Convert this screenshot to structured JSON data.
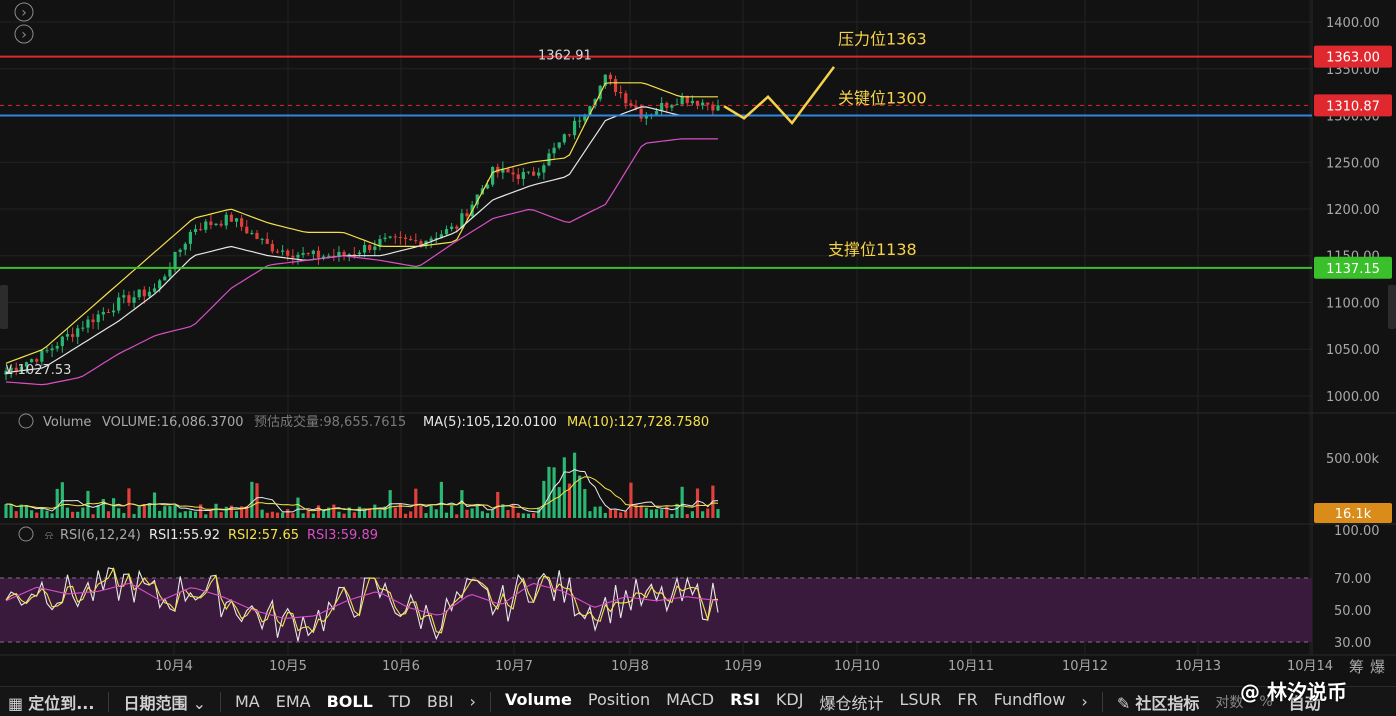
{
  "colors": {
    "background": "#121212",
    "grid": "#222222",
    "axis_text": "#a8a8a8",
    "up_candle": "#2bb673",
    "down_candle": "#e0403c",
    "resistance_line": "#e0292f",
    "key_line": "#2f86e0",
    "support_line": "#39c02a",
    "annotation": "#f5d24a",
    "boll_upper": "#f5e04a",
    "boll_mid": "#e8e8e8",
    "boll_lower": "#d84fc8",
    "rsi_band": "#3a1a3c"
  },
  "chart_data": [
    {
      "type": "candlestick",
      "ylim": [
        985,
        1415
      ],
      "yticks": [
        "1400.00",
        "1350.00",
        "1300.00",
        "1250.00",
        "1200.00",
        "1150.00",
        "1100.00",
        "1050.00",
        "1000.00"
      ],
      "price_tags": [
        {
          "label": "1363.00",
          "value": 1363,
          "color": "#e0292f"
        },
        {
          "label": "1310.87",
          "value": 1310.87,
          "color": "#e0292f"
        },
        {
          "label": "1137.15",
          "value": 1137.15,
          "color": "#39c02a"
        }
      ],
      "horizontal_lines": [
        {
          "value": 1363,
          "color": "#e0292f"
        },
        {
          "value": 1300,
          "color": "#2f86e0"
        },
        {
          "value": 1137,
          "color": "#39c02a"
        }
      ],
      "annotations": [
        {
          "text": "压力位1363",
          "value": 1363
        },
        {
          "text": "关键位1300",
          "value": 1300
        },
        {
          "text": "支撑位1138",
          "value": 1138
        }
      ],
      "high_label": "1362.91",
      "low_label": "1027.53",
      "projection": [
        1310,
        1297,
        1320,
        1292,
        1352
      ],
      "boll_upper_anchors": [
        1035,
        1050,
        1085,
        1120,
        1155,
        1190,
        1200,
        1185,
        1175,
        1175,
        1160,
        1160,
        1165,
        1240,
        1250,
        1255,
        1335,
        1335,
        1320,
        1320
      ],
      "boll_mid_anchors": [
        1025,
        1030,
        1055,
        1080,
        1110,
        1150,
        1160,
        1150,
        1145,
        1150,
        1150,
        1160,
        1175,
        1210,
        1225,
        1235,
        1295,
        1310,
        1300,
        1300
      ],
      "boll_lower_anchors": [
        1015,
        1012,
        1020,
        1045,
        1065,
        1075,
        1115,
        1140,
        1145,
        1150,
        1145,
        1138,
        1165,
        1190,
        1200,
        1185,
        1205,
        1270,
        1275,
        1275
      ],
      "close_anchors": [
        1027,
        1045,
        1075,
        1100,
        1115,
        1180,
        1190,
        1160,
        1150,
        1150,
        1165,
        1165,
        1180,
        1240,
        1235,
        1280,
        1340,
        1300,
        1320,
        1310
      ]
    },
    {
      "type": "bar",
      "name": "Volume",
      "ylim": [
        0,
        650
      ],
      "yticks": [
        "500.00k"
      ],
      "last_value_tag": "16.1k"
    },
    {
      "type": "line",
      "name": "RSI",
      "ylim": [
        25,
        100
      ],
      "yticks": [
        "100.00",
        "70.00",
        "50.00",
        "30.00"
      ],
      "band": [
        30,
        70
      ],
      "rsi_anchors": [
        55,
        65,
        60,
        62,
        68,
        55,
        65,
        58,
        48,
        42,
        44,
        55,
        62,
        50,
        44,
        60,
        52,
        68,
        62,
        50,
        58,
        55,
        58,
        55
      ]
    }
  ],
  "x_axis": {
    "labels": [
      "10月4",
      "10月5",
      "10月6",
      "10月7",
      "10月8",
      "10月9",
      "10月10",
      "10月11",
      "10月12",
      "10月13",
      "10月14"
    ]
  },
  "legends": {
    "volume": {
      "title": "Volume",
      "volume": "VOLUME:16,086.3700",
      "estimated": "预估成交量:98,655.7615",
      "ma5": "MA(5):105,120.0100",
      "ma10": "MA(10):127,728.7580"
    },
    "rsi": {
      "title": "RSI(6,12,24)",
      "rsi1": "RSI1:55.92",
      "rsi2": "RSI2:57.65",
      "rsi3": "RSI3:59.89"
    }
  },
  "right_edge": {
    "char1": "筹",
    "char2": "爆"
  },
  "toolbar": {
    "locate": "定位到...",
    "date_range": "日期范围",
    "main_indicators": [
      "MA",
      "EMA",
      "BOLL",
      "TD",
      "BBI"
    ],
    "active_main": "BOLL",
    "sub_indicators": [
      "Volume",
      "Position",
      "MACD",
      "RSI",
      "KDJ",
      "爆仓统计",
      "LSUR",
      "FR",
      "Fundflow"
    ],
    "community": "社区指标",
    "log_label": "对数",
    "percent_label": "%",
    "auto_label": "自动"
  },
  "watermark": "@ 林汐说币"
}
